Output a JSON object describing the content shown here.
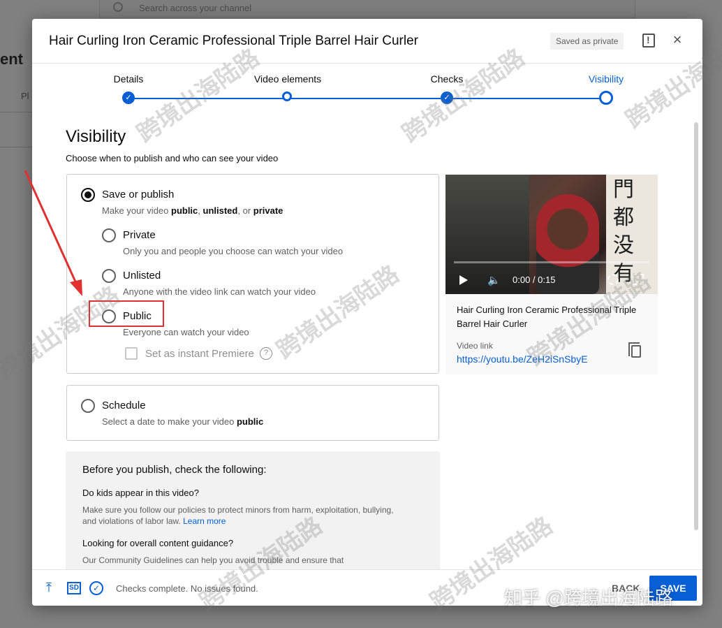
{
  "background": {
    "search_placeholder": "Search across your channel",
    "title_fragment": "ent",
    "tab_fragment": "Pl"
  },
  "dialog": {
    "title": "Hair Curling Iron Ceramic Professional Triple Barrel Hair Curler",
    "saved_badge": "Saved as private",
    "close_glyph": "×"
  },
  "stepper": {
    "steps": [
      {
        "label": "Details",
        "state": "done"
      },
      {
        "label": "Video elements",
        "state": "open"
      },
      {
        "label": "Checks",
        "state": "done"
      },
      {
        "label": "Visibility",
        "state": "current"
      }
    ],
    "done_glyph": "✓"
  },
  "visibility": {
    "heading": "Visibility",
    "subheading": "Choose when to publish and who can see your video",
    "save_or_publish": {
      "label": "Save or publish",
      "desc_prefix": "Make your video ",
      "desc_public": "public",
      "desc_sep1": ", ",
      "desc_unlisted": "unlisted",
      "desc_sep2": ", or ",
      "desc_private": "private",
      "selected": true
    },
    "options": [
      {
        "label": "Private",
        "desc": "Only you and people you choose can watch your video"
      },
      {
        "label": "Unlisted",
        "desc": "Anyone with the video link can watch your video"
      },
      {
        "label": "Public",
        "desc": "Everyone can watch your video"
      }
    ],
    "premiere_label": "Set as instant Premiere",
    "help_glyph": "?",
    "schedule": {
      "label": "Schedule",
      "desc_prefix": "Select a date to make your video ",
      "desc_bold": "public"
    }
  },
  "preview": {
    "time": "0:00 / 0:15",
    "title": "Hair Curling Iron Ceramic Professional Triple Barrel Hair Curler",
    "link_label": "Video link",
    "link_url": "https://youtu.be/ZeH2iSnSbyE",
    "overlay_chars": [
      "門",
      "都",
      "没",
      "有"
    ],
    "volume_glyph": "🔈"
  },
  "checklist": {
    "title": "Before you publish, check the following:",
    "q1": "Do kids appear in this video?",
    "p1": "Make sure you follow our policies to protect minors from harm, exploitation, bullying, and violations of labor law. ",
    "p1_link": "Learn more",
    "q2": "Looking for overall content guidance?",
    "p2": "Our Community Guidelines can help you avoid trouble and ensure that"
  },
  "footer": {
    "upload_glyph": "⤒",
    "sd_label": "SD",
    "check_glyph": "✓",
    "status": "Checks complete. No issues found.",
    "back": "BACK",
    "save": "SAVE"
  },
  "overlays": {
    "watermark": "跨境出海陆路",
    "zhihu": "知乎 @跨境出海陆路"
  },
  "colors": {
    "accent": "#065fd4",
    "annotation": "#e03030"
  }
}
